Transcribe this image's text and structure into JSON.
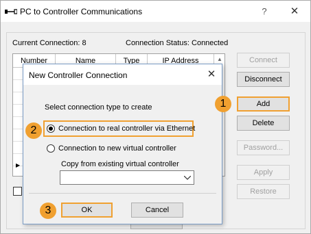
{
  "main_window": {
    "title": "PC to Controller Communications",
    "help_glyph": "?",
    "close_glyph": "✕",
    "current_connection": "Current Connection: 8",
    "connection_status": "Connection Status: Connected",
    "table_headers": [
      "Number",
      "Name",
      "Type",
      "IP Address"
    ],
    "buttons": {
      "connect": "Connect",
      "disconnect": "Disconnect",
      "add": "Add",
      "delete": "Delete",
      "password": "Password...",
      "apply": "Apply",
      "restore": "Restore"
    },
    "bottom_checkbox_checked": false
  },
  "dialog": {
    "title": "New Controller Connection",
    "close_glyph": "✕",
    "prompt": "Select connection type to create",
    "options": [
      {
        "label": "Connection to real controller via Ethernet",
        "selected": true
      },
      {
        "label": "Connection to new virtual controller",
        "selected": false
      }
    ],
    "copy_label": "Copy from existing virtual controller",
    "copy_value": "",
    "ok": "OK",
    "cancel": "Cancel"
  },
  "steps": [
    "1",
    "2",
    "3"
  ],
  "icons": {
    "app": "connection-plug-icon",
    "chevron": "chevron-down-icon",
    "scroll_up": "scroll-up-arrow-icon",
    "row_pointer": "row-pointer-icon"
  },
  "colors": {
    "highlight": "#f0a030",
    "dialog_border": "#7a9cc6"
  }
}
